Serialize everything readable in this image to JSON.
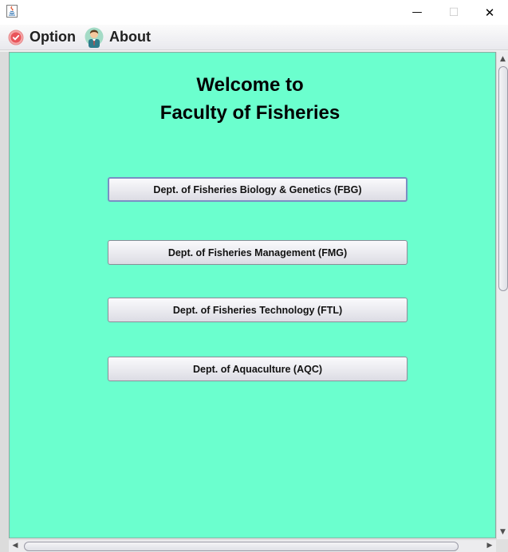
{
  "menu": {
    "option_label": "Option",
    "about_label": "About"
  },
  "window_controls": {
    "minimize": "—",
    "maximize": "☐",
    "close": "✕"
  },
  "main": {
    "title_line1": "Welcome to",
    "title_line2": "Faculty of Fisheries",
    "background_color": "#6bffce",
    "departments": [
      {
        "label": "Dept. of Fisheries Biology & Genetics (FBG)"
      },
      {
        "label": "Dept. of Fisheries Management (FMG)"
      },
      {
        "label": "Dept. of Fisheries Technology (FTL)"
      },
      {
        "label": "Dept. of Aquaculture (AQC)"
      }
    ]
  },
  "icons": {
    "app": "java-app-icon",
    "option": "check-circle-icon",
    "about": "person-icon"
  }
}
